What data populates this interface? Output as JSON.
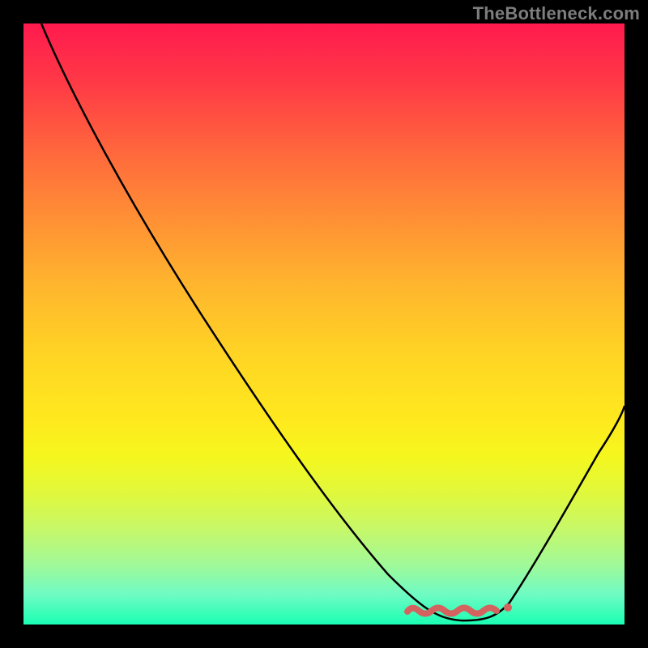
{
  "watermark": "TheBottleneck.com",
  "chart_data": {
    "type": "line",
    "title": "",
    "xlabel": "",
    "ylabel": "",
    "xlim": [
      0,
      100
    ],
    "ylim": [
      0,
      100
    ],
    "series": [
      {
        "name": "curve",
        "x": [
          3,
          10,
          20,
          30,
          40,
          50,
          60,
          65,
          68,
          70,
          72,
          75,
          78,
          80,
          82,
          85,
          90,
          95,
          100
        ],
        "values": [
          100,
          90,
          76,
          62,
          48,
          34,
          20,
          12,
          6,
          2,
          1,
          0,
          0,
          0.5,
          1.5,
          5,
          15,
          27,
          40
        ]
      }
    ],
    "markers": {
      "name": "bottom-squiggle",
      "x_start": 65,
      "x_end": 80,
      "y": 1,
      "color": "#d4635f"
    },
    "axes_visible": false,
    "grid": false
  }
}
